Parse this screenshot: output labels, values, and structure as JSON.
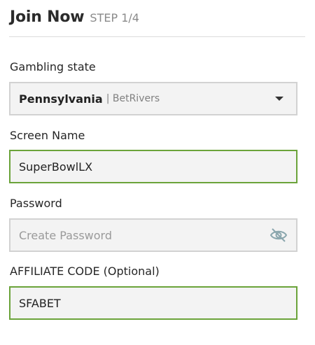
{
  "header": {
    "title": "Join Now",
    "step": "STEP 1/4"
  },
  "state_field": {
    "label": "Gambling state",
    "selected_state": "Pennsylvania",
    "selected_brand": "| BetRivers"
  },
  "screen_name_field": {
    "label": "Screen Name",
    "value": "SuperBowlLX"
  },
  "password_field": {
    "label": "Password",
    "placeholder": "Create Password",
    "toggle_icon": "eye-slash-icon"
  },
  "affiliate_field": {
    "label": "AFFILIATE CODE (Optional)",
    "value": "SFABET"
  },
  "colors": {
    "valid_border": "#6ba33a",
    "default_border": "#d2d2d2",
    "field_bg": "#f3f3f3"
  }
}
